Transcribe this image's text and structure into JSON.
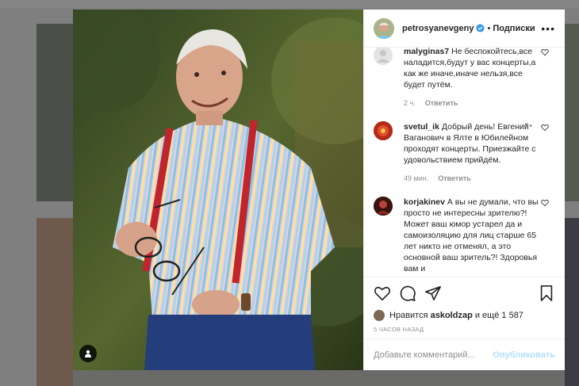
{
  "post": {
    "username": "petrosyanevgeny",
    "follow_label": "Подписки",
    "separator": "•",
    "more_label": "•••"
  },
  "comments": [
    {
      "username": "malyginas7",
      "text": "Не беспокойтесь,все наладится,будут у вас концерты,а как же иначе,иначе нельзя,все будет путём.",
      "time": "2 ч.",
      "reply": "Ответить",
      "avatar_color": "#e4e4e4"
    },
    {
      "username": "svetul_ik",
      "text": "Добрый день! Евгений Ваганович в Ялте в Юбилейном проходят концерты. Приезжайте с удовольствием прийдём.",
      "time": "49 мин.",
      "reply": "Ответить",
      "avatar_color": "#c4381f"
    },
    {
      "username": "korjakinev",
      "text": "А вы не думали, что вы просто не интересны зрителю?! Может ваш юмор устарел да и самоизоляцию для лиц старше 65 лет никто не отменял, а это основной ваш зритель?! Здоровья вам и",
      "time": "",
      "reply": "",
      "avatar_color": "#6b1d1d"
    }
  ],
  "likes": {
    "prefix": "Нравится",
    "user": "askoldzap",
    "suffix": "и ещё 1 587"
  },
  "time_ago": "5 ЧАСОВ НАЗАД",
  "add_comment": {
    "placeholder": "Добавьте комментарий...",
    "publish_label": "Опубликовать"
  },
  "colors": {
    "verified": "#3897f0",
    "publish": "#b2dffc"
  }
}
